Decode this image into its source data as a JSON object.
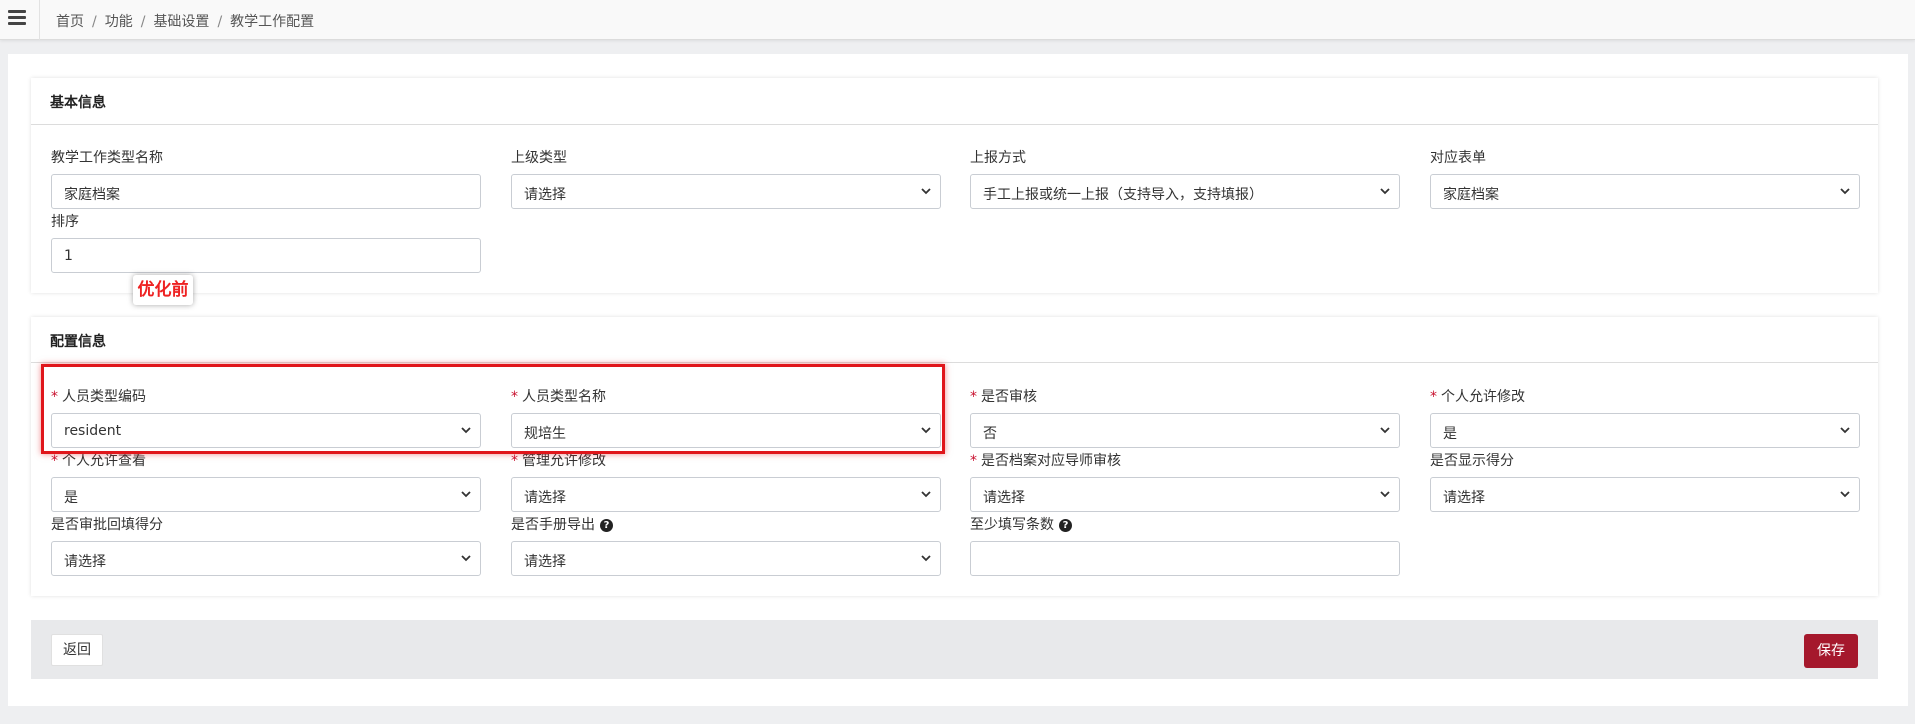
{
  "breadcrumb": {
    "items": [
      "首页",
      "功能",
      "基础设置",
      "教学工作配置"
    ],
    "separator": "/"
  },
  "basic": {
    "title": "基本信息",
    "fields": {
      "type_name": {
        "label": "教学工作类型名称",
        "value": "家庭档案"
      },
      "parent_type": {
        "label": "上级类型",
        "value": "请选择"
      },
      "report_method": {
        "label": "上报方式",
        "value": "手工上报或统一上报（支持导入，支持填报）"
      },
      "form": {
        "label": "对应表单",
        "value": "家庭档案"
      },
      "sort": {
        "label": "排序",
        "value": "1"
      }
    }
  },
  "config": {
    "title": "配置信息",
    "annotation": "优化前",
    "fields": {
      "person_type_code": {
        "label": "人员类型编码",
        "value": "resident",
        "required": "*"
      },
      "person_type_name": {
        "label": "人员类型名称",
        "value": "规培生",
        "required": "*"
      },
      "need_review": {
        "label": "是否审核",
        "value": "否",
        "required": "*"
      },
      "personal_allow_edit": {
        "label": "个人允许修改",
        "value": "是",
        "required": "*"
      },
      "personal_allow_view": {
        "label": "个人允许查看",
        "value": "是",
        "required": "*"
      },
      "admin_allow_edit": {
        "label": "管理允许修改",
        "value": "请选择",
        "required": "*"
      },
      "tutor_review": {
        "label": "是否档案对应导师审核",
        "value": "请选择",
        "required": "*"
      },
      "show_score": {
        "label": "是否显示得分",
        "value": "请选择"
      },
      "review_backfill_score": {
        "label": "是否审批回填得分",
        "value": "请选择"
      },
      "manual_export": {
        "label": "是否手册导出",
        "value": "请选择",
        "help_icon": "?"
      },
      "min_entries": {
        "label": "至少填写条数",
        "value": "",
        "help_icon": "?"
      }
    }
  },
  "footer": {
    "back_label": "返回",
    "save_label": "保存"
  },
  "colors": {
    "primary": "#a5182c",
    "required": "#c8102e",
    "annotation": "#e0161b"
  }
}
